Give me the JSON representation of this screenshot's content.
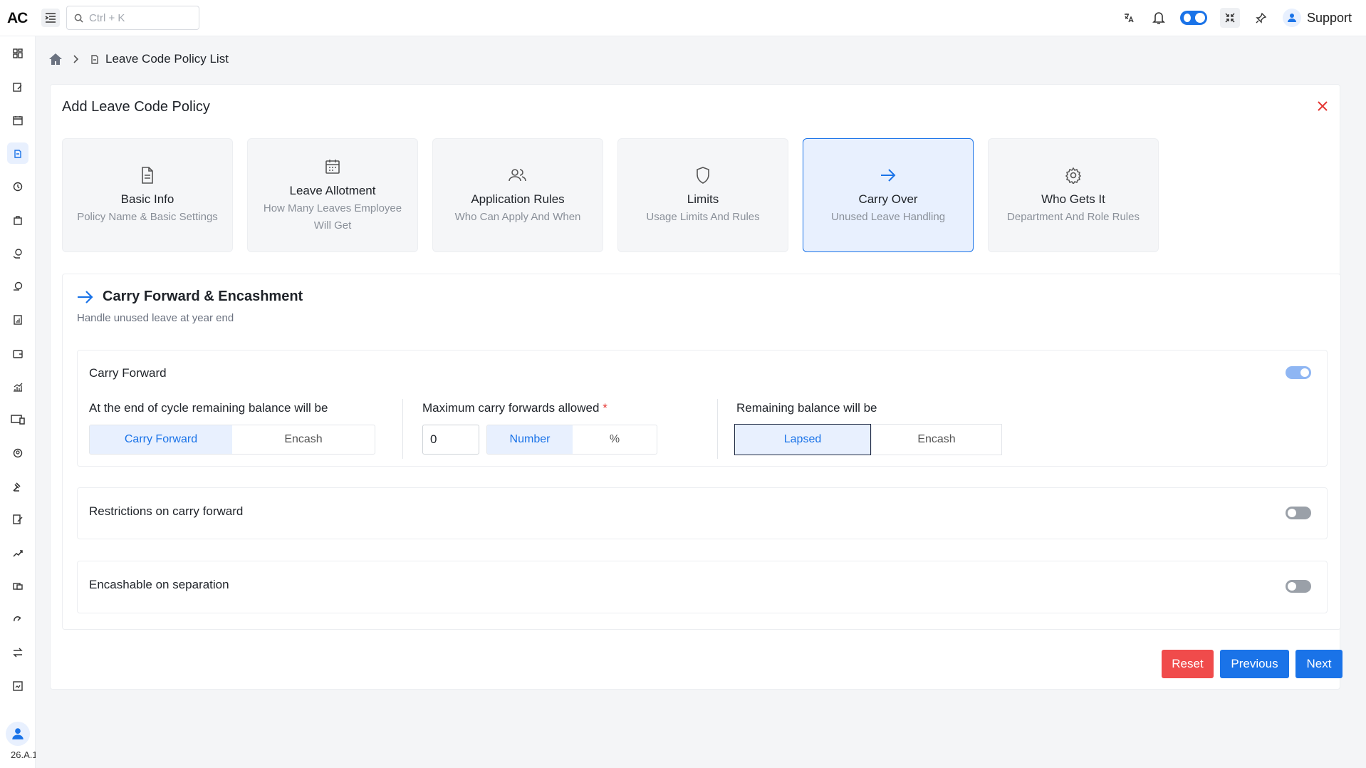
{
  "app": {
    "logo": "AC",
    "search_placeholder": "Ctrl + K",
    "support_label": "Support",
    "version": "26.A.1"
  },
  "breadcrumb": {
    "page": "Leave Code Policy List"
  },
  "panel": {
    "title": "Add Leave Code Policy"
  },
  "steps": [
    {
      "title": "Basic Info",
      "subtitle": "Policy Name & Basic Settings",
      "icon": "document-icon"
    },
    {
      "title": "Leave Allotment",
      "subtitle": "How Many Leaves Employee Will Get",
      "icon": "calendar-icon"
    },
    {
      "title": "Application Rules",
      "subtitle": "Who Can Apply And When",
      "icon": "users-icon"
    },
    {
      "title": "Limits",
      "subtitle": "Usage Limits And Rules",
      "icon": "shield-icon"
    },
    {
      "title": "Carry Over",
      "subtitle": "Unused Leave Handling",
      "icon": "arrow-right-icon",
      "active": true
    },
    {
      "title": "Who Gets It",
      "subtitle": "Department And Role Rules",
      "icon": "gear-icon"
    }
  ],
  "section": {
    "title": "Carry Forward & Encashment",
    "subtitle": "Handle unused leave at year end",
    "carry_forward": {
      "label": "Carry Forward",
      "enabled": true,
      "end_of_cycle_label": "At the end of cycle remaining balance will be",
      "end_of_cycle_options": [
        "Carry Forward",
        "Encash"
      ],
      "end_of_cycle_selected": "Carry Forward",
      "max_label": "Maximum carry forwards allowed",
      "max_required": "*",
      "max_value": "0",
      "max_unit_options": [
        "Number",
        "%"
      ],
      "max_unit_selected": "Number",
      "remaining_label": "Remaining balance will be",
      "remaining_options": [
        "Lapsed",
        "Encash"
      ],
      "remaining_selected": "Lapsed"
    },
    "restrictions": {
      "label": "Restrictions on carry forward",
      "enabled": false
    },
    "encashable": {
      "label": "Encashable on separation",
      "enabled": false
    }
  },
  "actions": {
    "reset": "Reset",
    "previous": "Previous",
    "next": "Next"
  },
  "colors": {
    "primary": "#1a73e8",
    "danger": "#f04b4b",
    "active_bg": "#e8f0fe"
  }
}
